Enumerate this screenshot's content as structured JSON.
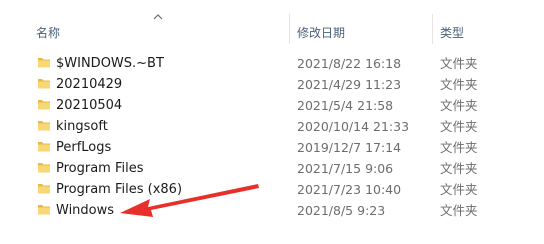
{
  "columns": {
    "name": "名称",
    "modified": "修改日期",
    "type": "类型"
  },
  "sort": {
    "column": "name",
    "direction": "ascending",
    "icon": "chevron-up-icon"
  },
  "files": [
    {
      "name": "$WINDOWS.~BT",
      "modified": "2021/8/22 16:18",
      "type": "文件夹",
      "icon": "folder-icon"
    },
    {
      "name": "20210429",
      "modified": "2021/4/29 11:23",
      "type": "文件夹",
      "icon": "folder-icon"
    },
    {
      "name": "20210504",
      "modified": "2021/5/4 21:58",
      "type": "文件夹",
      "icon": "folder-icon"
    },
    {
      "name": "kingsoft",
      "modified": "2020/10/14 21:33",
      "type": "文件夹",
      "icon": "folder-icon"
    },
    {
      "name": "PerfLogs",
      "modified": "2019/12/7 17:14",
      "type": "文件夹",
      "icon": "folder-icon"
    },
    {
      "name": "Program Files",
      "modified": "2021/7/15 9:06",
      "type": "文件夹",
      "icon": "folder-icon"
    },
    {
      "name": "Program Files (x86)",
      "modified": "2021/7/23 10:40",
      "type": "文件夹",
      "icon": "folder-icon"
    },
    {
      "name": "Windows",
      "modified": "2021/8/5 9:23",
      "type": "文件夹",
      "icon": "folder-icon"
    }
  ],
  "annotation": {
    "icon": "red-arrow-icon",
    "target": "Windows",
    "color": "#e8302a"
  },
  "colors": {
    "header_text": "#4c607a",
    "folder_fill": "#f8d775",
    "folder_tab": "#e8b94a",
    "secondary_text": "#6d6d6d",
    "arrow": "#e8302a"
  }
}
